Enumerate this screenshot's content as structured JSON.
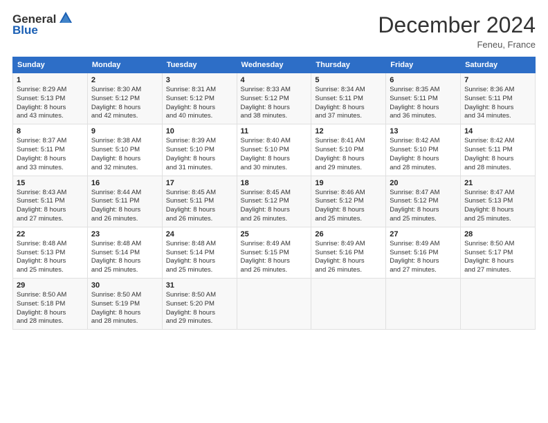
{
  "logo": {
    "line1": "General",
    "line2": "Blue"
  },
  "header": {
    "month": "December 2024",
    "location": "Feneu, France"
  },
  "weekdays": [
    "Sunday",
    "Monday",
    "Tuesday",
    "Wednesday",
    "Thursday",
    "Friday",
    "Saturday"
  ],
  "weeks": [
    [
      {
        "day": "1",
        "lines": [
          "Sunrise: 8:29 AM",
          "Sunset: 5:13 PM",
          "Daylight: 8 hours",
          "and 43 minutes."
        ]
      },
      {
        "day": "2",
        "lines": [
          "Sunrise: 8:30 AM",
          "Sunset: 5:12 PM",
          "Daylight: 8 hours",
          "and 42 minutes."
        ]
      },
      {
        "day": "3",
        "lines": [
          "Sunrise: 8:31 AM",
          "Sunset: 5:12 PM",
          "Daylight: 8 hours",
          "and 40 minutes."
        ]
      },
      {
        "day": "4",
        "lines": [
          "Sunrise: 8:33 AM",
          "Sunset: 5:12 PM",
          "Daylight: 8 hours",
          "and 38 minutes."
        ]
      },
      {
        "day": "5",
        "lines": [
          "Sunrise: 8:34 AM",
          "Sunset: 5:11 PM",
          "Daylight: 8 hours",
          "and 37 minutes."
        ]
      },
      {
        "day": "6",
        "lines": [
          "Sunrise: 8:35 AM",
          "Sunset: 5:11 PM",
          "Daylight: 8 hours",
          "and 36 minutes."
        ]
      },
      {
        "day": "7",
        "lines": [
          "Sunrise: 8:36 AM",
          "Sunset: 5:11 PM",
          "Daylight: 8 hours",
          "and 34 minutes."
        ]
      }
    ],
    [
      {
        "day": "8",
        "lines": [
          "Sunrise: 8:37 AM",
          "Sunset: 5:11 PM",
          "Daylight: 8 hours",
          "and 33 minutes."
        ]
      },
      {
        "day": "9",
        "lines": [
          "Sunrise: 8:38 AM",
          "Sunset: 5:10 PM",
          "Daylight: 8 hours",
          "and 32 minutes."
        ]
      },
      {
        "day": "10",
        "lines": [
          "Sunrise: 8:39 AM",
          "Sunset: 5:10 PM",
          "Daylight: 8 hours",
          "and 31 minutes."
        ]
      },
      {
        "day": "11",
        "lines": [
          "Sunrise: 8:40 AM",
          "Sunset: 5:10 PM",
          "Daylight: 8 hours",
          "and 30 minutes."
        ]
      },
      {
        "day": "12",
        "lines": [
          "Sunrise: 8:41 AM",
          "Sunset: 5:10 PM",
          "Daylight: 8 hours",
          "and 29 minutes."
        ]
      },
      {
        "day": "13",
        "lines": [
          "Sunrise: 8:42 AM",
          "Sunset: 5:10 PM",
          "Daylight: 8 hours",
          "and 28 minutes."
        ]
      },
      {
        "day": "14",
        "lines": [
          "Sunrise: 8:42 AM",
          "Sunset: 5:11 PM",
          "Daylight: 8 hours",
          "and 28 minutes."
        ]
      }
    ],
    [
      {
        "day": "15",
        "lines": [
          "Sunrise: 8:43 AM",
          "Sunset: 5:11 PM",
          "Daylight: 8 hours",
          "and 27 minutes."
        ]
      },
      {
        "day": "16",
        "lines": [
          "Sunrise: 8:44 AM",
          "Sunset: 5:11 PM",
          "Daylight: 8 hours",
          "and 26 minutes."
        ]
      },
      {
        "day": "17",
        "lines": [
          "Sunrise: 8:45 AM",
          "Sunset: 5:11 PM",
          "Daylight: 8 hours",
          "and 26 minutes."
        ]
      },
      {
        "day": "18",
        "lines": [
          "Sunrise: 8:45 AM",
          "Sunset: 5:12 PM",
          "Daylight: 8 hours",
          "and 26 minutes."
        ]
      },
      {
        "day": "19",
        "lines": [
          "Sunrise: 8:46 AM",
          "Sunset: 5:12 PM",
          "Daylight: 8 hours",
          "and 25 minutes."
        ]
      },
      {
        "day": "20",
        "lines": [
          "Sunrise: 8:47 AM",
          "Sunset: 5:12 PM",
          "Daylight: 8 hours",
          "and 25 minutes."
        ]
      },
      {
        "day": "21",
        "lines": [
          "Sunrise: 8:47 AM",
          "Sunset: 5:13 PM",
          "Daylight: 8 hours",
          "and 25 minutes."
        ]
      }
    ],
    [
      {
        "day": "22",
        "lines": [
          "Sunrise: 8:48 AM",
          "Sunset: 5:13 PM",
          "Daylight: 8 hours",
          "and 25 minutes."
        ]
      },
      {
        "day": "23",
        "lines": [
          "Sunrise: 8:48 AM",
          "Sunset: 5:14 PM",
          "Daylight: 8 hours",
          "and 25 minutes."
        ]
      },
      {
        "day": "24",
        "lines": [
          "Sunrise: 8:48 AM",
          "Sunset: 5:14 PM",
          "Daylight: 8 hours",
          "and 25 minutes."
        ]
      },
      {
        "day": "25",
        "lines": [
          "Sunrise: 8:49 AM",
          "Sunset: 5:15 PM",
          "Daylight: 8 hours",
          "and 26 minutes."
        ]
      },
      {
        "day": "26",
        "lines": [
          "Sunrise: 8:49 AM",
          "Sunset: 5:16 PM",
          "Daylight: 8 hours",
          "and 26 minutes."
        ]
      },
      {
        "day": "27",
        "lines": [
          "Sunrise: 8:49 AM",
          "Sunset: 5:16 PM",
          "Daylight: 8 hours",
          "and 27 minutes."
        ]
      },
      {
        "day": "28",
        "lines": [
          "Sunrise: 8:50 AM",
          "Sunset: 5:17 PM",
          "Daylight: 8 hours",
          "and 27 minutes."
        ]
      }
    ],
    [
      {
        "day": "29",
        "lines": [
          "Sunrise: 8:50 AM",
          "Sunset: 5:18 PM",
          "Daylight: 8 hours",
          "and 28 minutes."
        ]
      },
      {
        "day": "30",
        "lines": [
          "Sunrise: 8:50 AM",
          "Sunset: 5:19 PM",
          "Daylight: 8 hours",
          "and 28 minutes."
        ]
      },
      {
        "day": "31",
        "lines": [
          "Sunrise: 8:50 AM",
          "Sunset: 5:20 PM",
          "Daylight: 8 hours",
          "and 29 minutes."
        ]
      },
      null,
      null,
      null,
      null
    ]
  ]
}
